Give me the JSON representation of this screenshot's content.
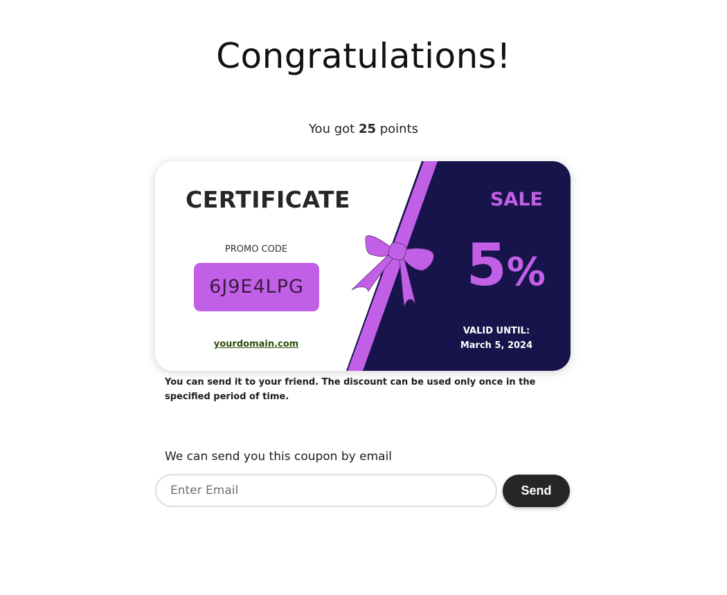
{
  "header": {
    "title": "Congratulations!",
    "points_prefix": "You got",
    "points_value": "25",
    "points_suffix": "points"
  },
  "certificate": {
    "title": "CERTIFICATE",
    "promo_label": "PROMO CODE",
    "promo_code": "6J9E4LPG",
    "domain": "yourdomain.com",
    "sale_label": "SALE",
    "discount_number": "5",
    "discount_symbol": "%",
    "valid_label": "VALID UNTIL:",
    "valid_date": "March 5, 2024",
    "colors": {
      "accent": "#c160e6",
      "dark_panel": "#16144a",
      "text_dark": "#262626"
    },
    "icons": {
      "ribbon": "bow-ribbon-icon"
    }
  },
  "note": "You can send it to your friend. The discount can be used only once in the specified period of time.",
  "email_form": {
    "prompt": "We can send you this coupon by email",
    "placeholder": "Enter Email",
    "value": "",
    "send_label": "Send"
  }
}
